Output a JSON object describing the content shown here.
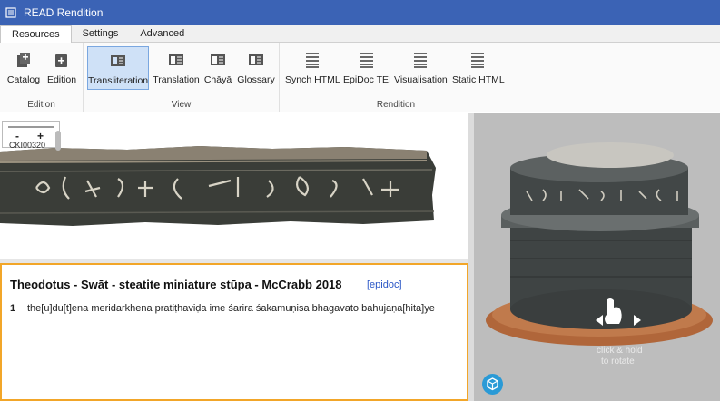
{
  "window": {
    "title": "READ Rendition",
    "accent": "#3b63b5"
  },
  "tabs": [
    "Resources",
    "Settings",
    "Advanced"
  ],
  "ribbon": {
    "groups": [
      {
        "label": "Edition",
        "buttons": [
          {
            "label": "Catalog",
            "icon": "catalog-add-icon"
          },
          {
            "label": "Edition",
            "icon": "edition-add-icon"
          }
        ]
      },
      {
        "label": "View",
        "buttons": [
          {
            "label": "Transliteration",
            "icon": "book-icon",
            "selected": true
          },
          {
            "label": "Translation",
            "icon": "book-icon"
          },
          {
            "label": "Chāyā",
            "icon": "book-icon"
          },
          {
            "label": "Glossary",
            "icon": "book-icon"
          }
        ]
      },
      {
        "label": "Rendition",
        "buttons": [
          {
            "label": "Synch HTML",
            "icon": "lines-icon"
          },
          {
            "label": "EpiDoc TEI",
            "icon": "lines-icon"
          },
          {
            "label": "Visualisation",
            "icon": "lines-icon"
          },
          {
            "label": "Static HTML",
            "icon": "lines-icon"
          }
        ]
      }
    ]
  },
  "image_viewer": {
    "zoom_minus": "-",
    "zoom_plus": "+",
    "image_id": "CKI00320"
  },
  "document": {
    "title": "Theodotus - Swāt - steatite miniature stūpa - McCrabb 2018",
    "link": "[epidoc]",
    "lines": [
      {
        "num": "1",
        "text": "the[u]du[t]ena meridarkhena pratiṭhaviḍa ime śarira śakamuṇisa bhagavato bahujaṇa[hita]ye"
      }
    ]
  },
  "model_viewer": {
    "hint_line1": "click & hold",
    "hint_line2": "to rotate"
  }
}
